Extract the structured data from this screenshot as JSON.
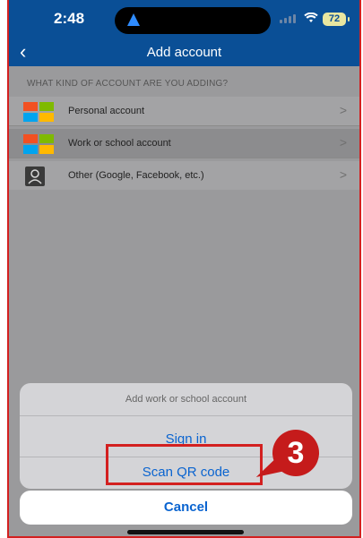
{
  "status_bar": {
    "time": "2:48",
    "battery": "72"
  },
  "nav": {
    "back_icon": "chevron-left-icon",
    "title": "Add account"
  },
  "section_header": "WHAT KIND OF ACCOUNT ARE YOU ADDING?",
  "accounts": [
    {
      "label": "Personal account",
      "icon": "microsoft-logo-icon"
    },
    {
      "label": "Work or school account",
      "icon": "microsoft-logo-icon"
    },
    {
      "label": "Other (Google, Facebook, etc.)",
      "icon": "person-icon"
    }
  ],
  "sheet": {
    "title": "Add work or school account",
    "sign_in": "Sign in",
    "scan_qr": "Scan QR code",
    "cancel": "Cancel"
  },
  "annotation": {
    "step": "3"
  },
  "colors": {
    "header_blue": "#0a4f96",
    "action_blue": "#0a64d0",
    "highlight_red": "#d32020"
  }
}
